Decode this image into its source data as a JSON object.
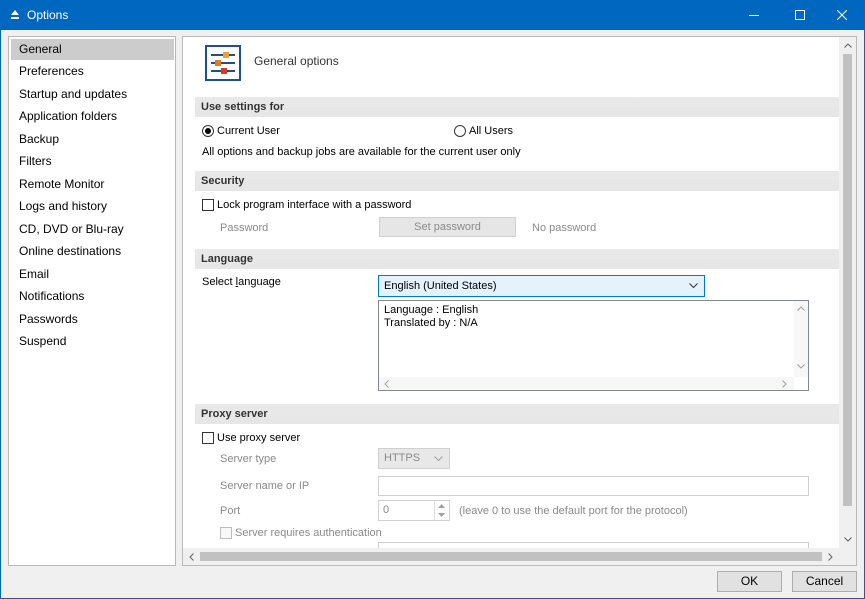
{
  "window": {
    "title": "Options",
    "controls": {
      "minimize": "minimize-icon",
      "maximize": "maximize-icon",
      "close": "close-icon"
    }
  },
  "sidebar": {
    "items": [
      {
        "label": "General",
        "selected": true
      },
      {
        "label": "Preferences"
      },
      {
        "label": "Startup and updates"
      },
      {
        "label": "Application folders"
      },
      {
        "label": "Backup"
      },
      {
        "label": "Filters"
      },
      {
        "label": "Remote Monitor"
      },
      {
        "label": "Logs and history"
      },
      {
        "label": "CD, DVD or Blu-ray"
      },
      {
        "label": "Online destinations"
      },
      {
        "label": "Email"
      },
      {
        "label": "Notifications"
      },
      {
        "label": "Passwords"
      },
      {
        "label": "Suspend"
      }
    ]
  },
  "main": {
    "header": {
      "title": "General options",
      "icon": "settings-sliders-icon"
    },
    "use_settings": {
      "section": "Use settings for",
      "current_user": "Current User",
      "all_users": "All Users",
      "selected": "Current User",
      "note": "All options and backup jobs are available for the current user only"
    },
    "security": {
      "section": "Security",
      "lock_label": "Lock program interface with a password",
      "lock_checked": false,
      "password_label": "Password",
      "set_password_button": "Set password",
      "password_status": "No password"
    },
    "language": {
      "section": "Language",
      "select_label_pre": "Select ",
      "select_label_accel": "l",
      "select_label_post": "anguage",
      "selected": "English (United States)",
      "info_line1": "Language : English",
      "info_line2": "Translated by : N/A"
    },
    "proxy": {
      "section": "Proxy server",
      "use_label": "Use proxy server",
      "use_checked": false,
      "server_type_label": "Server type",
      "server_type_value": "HTTPS",
      "server_name_label": "Server name or IP",
      "server_name_value": "",
      "port_label": "Port",
      "port_value": "0",
      "port_hint": "(leave 0 to use the default port for the protocol)",
      "auth_label": "Server requires authentication",
      "auth_checked": false
    }
  },
  "footer": {
    "ok": "OK",
    "cancel": "Cancel"
  },
  "colors": {
    "titlebar": "#0067c0",
    "selected_item": "#cccccc",
    "section_bar": "#e9e9e9"
  }
}
